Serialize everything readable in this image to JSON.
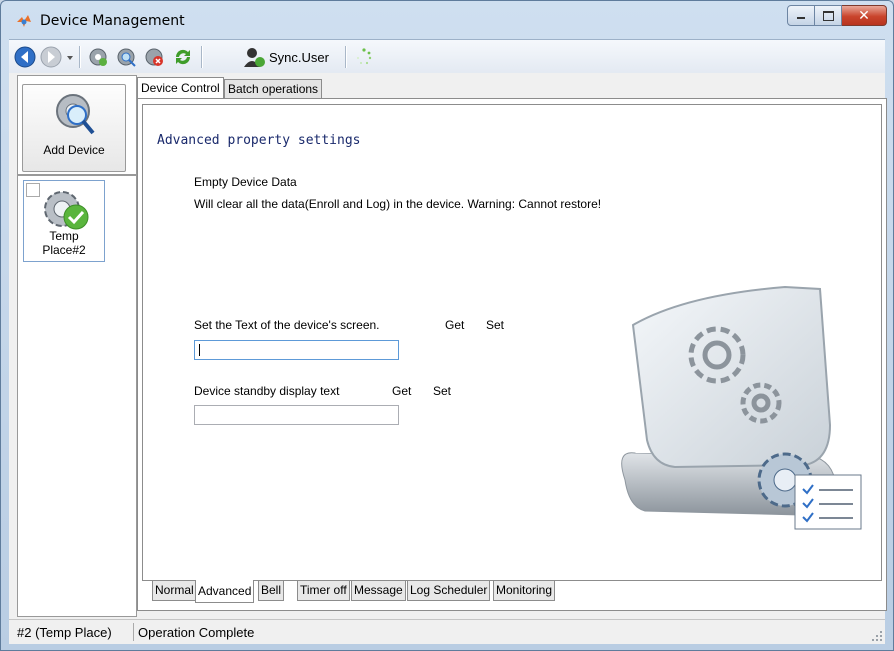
{
  "window": {
    "title": "Device Management",
    "buttons": [
      "minimize",
      "maximize",
      "close"
    ]
  },
  "toolbar": {
    "items": [
      "back-icon",
      "forward-icon",
      "dropdown-icon",
      "device-settings-icon",
      "device-search-icon",
      "device-delete-icon",
      "refresh-icon",
      "sync-user-icon",
      "loading-icon"
    ],
    "sync_user_label": "Sync.User"
  },
  "left_pane": {
    "add_device_label": "Add Device",
    "device": {
      "name_line1": "Temp",
      "name_line2": "Place#2",
      "checked": false,
      "status": "connected"
    }
  },
  "top_tabs": [
    {
      "label": "Device Control",
      "active": true
    },
    {
      "label": "Batch operations",
      "active": false
    }
  ],
  "advanced": {
    "heading": "Advanced property settings",
    "empty_data_link": "Empty Device Data",
    "empty_data_desc": "Will clear all the data(Enroll and Log) in the device. Warning: Cannot restore!",
    "screen_text_label": "Set the Text of the device's screen.",
    "screen_text_get": "Get",
    "screen_text_set": "Set",
    "screen_text_value": "",
    "standby_label": "Device standby display text",
    "standby_get": "Get",
    "standby_set": "Set",
    "standby_value": ""
  },
  "bottom_tabs": [
    {
      "label": "Normal",
      "active": false
    },
    {
      "label": "Advanced",
      "active": true
    },
    {
      "label": "Bell",
      "active": false
    },
    {
      "label": "Timer off",
      "active": false
    },
    {
      "label": "Message",
      "active": false
    },
    {
      "label": "Log Scheduler",
      "active": false
    },
    {
      "label": "Monitoring",
      "active": false
    }
  ],
  "status": {
    "device": "#2 (Temp Place)",
    "message": "Operation Complete"
  },
  "colors": {
    "link": "#1b6ec2",
    "heading": "#1a2a6c",
    "close_button": "#c9442c"
  }
}
